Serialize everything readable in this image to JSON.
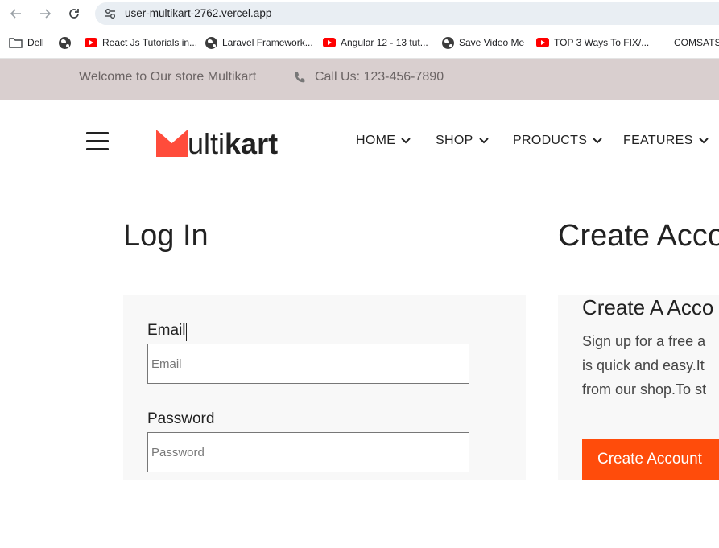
{
  "browser": {
    "url": "user-multikart-2762.vercel.app",
    "bookmarks": [
      {
        "label": "Dell",
        "icon": "folder-icon"
      },
      {
        "label": "React Js Tutorials in...",
        "icon": "youtube-icon"
      },
      {
        "label": "Laravel Framework...",
        "icon": "globe-icon"
      },
      {
        "label": "Angular 12 - 13 tut...",
        "icon": "youtube-icon"
      },
      {
        "label": "Save Video Me",
        "icon": "globe-icon"
      },
      {
        "label": "TOP 3 Ways To FIX/...",
        "icon": "youtube-icon"
      },
      {
        "label": "COMSATS",
        "icon": "none"
      }
    ]
  },
  "top_strip": {
    "welcome": "Welcome to Our store Multikart",
    "call": "Call Us: 123-456-7890"
  },
  "header": {
    "logo_text_light": "ulti",
    "logo_text_bold": "kart",
    "menu": [
      {
        "label": "HOME"
      },
      {
        "label": "SHOP"
      },
      {
        "label": "PRODUCTS"
      },
      {
        "label": "FEATURES"
      }
    ]
  },
  "login": {
    "title": "Log In",
    "email_label": "Email",
    "email_placeholder": "Email",
    "email_value": "",
    "password_label": "Password",
    "password_placeholder": "Password",
    "password_value": ""
  },
  "register": {
    "title": "Create Acco",
    "subtitle": "Create A Acco",
    "desc_lines": [
      "Sign up for a free a",
      "is quick and easy.It",
      "from our shop.To st"
    ],
    "button": "Create Account"
  },
  "colors": {
    "accent": "#ff4c3b",
    "button": "#ff4c0b",
    "strip_bg": "#d9cfcf"
  }
}
